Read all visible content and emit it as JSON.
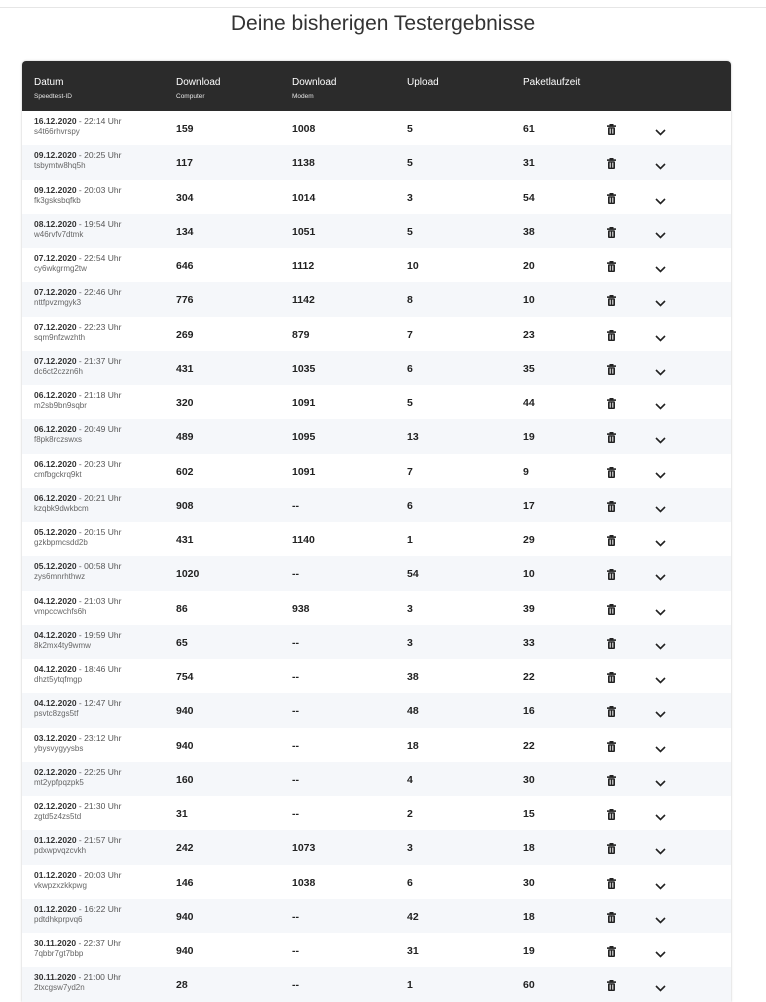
{
  "title": "Deine bisherigen Testergebnisse",
  "columns": [
    {
      "main": "Datum",
      "sub": "Speedtest-ID"
    },
    {
      "main": "Download",
      "sub": "Computer"
    },
    {
      "main": "Download",
      "sub": "Modem"
    },
    {
      "main": "Upload",
      "sub": ""
    },
    {
      "main": "Paketlaufzeit",
      "sub": ""
    }
  ],
  "rows": [
    {
      "date": "16.12.2020",
      "time": " - 22:14 Uhr",
      "id": "s4t66rhvrspy",
      "dl_pc": "159",
      "dl_modem": "1008",
      "ul": "5",
      "ping": "61"
    },
    {
      "date": "09.12.2020",
      "time": " - 20:25 Uhr",
      "id": "tsbymtw8hq5h",
      "dl_pc": "117",
      "dl_modem": "1138",
      "ul": "5",
      "ping": "31"
    },
    {
      "date": "09.12.2020",
      "time": " - 20:03 Uhr",
      "id": "fk3gsksbqfkb",
      "dl_pc": "304",
      "dl_modem": "1014",
      "ul": "3",
      "ping": "54"
    },
    {
      "date": "08.12.2020",
      "time": " - 19:54 Uhr",
      "id": "w46rvfv7dtmk",
      "dl_pc": "134",
      "dl_modem": "1051",
      "ul": "5",
      "ping": "38"
    },
    {
      "date": "07.12.2020",
      "time": " - 22:54 Uhr",
      "id": "cy6wkgrmg2tw",
      "dl_pc": "646",
      "dl_modem": "1112",
      "ul": "10",
      "ping": "20"
    },
    {
      "date": "07.12.2020",
      "time": " - 22:46 Uhr",
      "id": "nttfpvzmgyk3",
      "dl_pc": "776",
      "dl_modem": "1142",
      "ul": "8",
      "ping": "10"
    },
    {
      "date": "07.12.2020",
      "time": " - 22:23 Uhr",
      "id": "sqm9nfzwzhth",
      "dl_pc": "269",
      "dl_modem": "879",
      "ul": "7",
      "ping": "23"
    },
    {
      "date": "07.12.2020",
      "time": " - 21:37 Uhr",
      "id": "dc6ct2czzn6h",
      "dl_pc": "431",
      "dl_modem": "1035",
      "ul": "6",
      "ping": "35"
    },
    {
      "date": "06.12.2020",
      "time": " - 21:18 Uhr",
      "id": "m2sb9bn9sqbr",
      "dl_pc": "320",
      "dl_modem": "1091",
      "ul": "5",
      "ping": "44"
    },
    {
      "date": "06.12.2020",
      "time": " - 20:49 Uhr",
      "id": "f8pk8rczswxs",
      "dl_pc": "489",
      "dl_modem": "1095",
      "ul": "13",
      "ping": "19"
    },
    {
      "date": "06.12.2020",
      "time": " - 20:23 Uhr",
      "id": "cmfbgckrq9kt",
      "dl_pc": "602",
      "dl_modem": "1091",
      "ul": "7",
      "ping": "9"
    },
    {
      "date": "06.12.2020",
      "time": " - 20:21 Uhr",
      "id": "kzqbk9dwkbcm",
      "dl_pc": "908",
      "dl_modem": "--",
      "ul": "6",
      "ping": "17"
    },
    {
      "date": "05.12.2020",
      "time": " - 20:15 Uhr",
      "id": "gzkbpmcsdd2b",
      "dl_pc": "431",
      "dl_modem": "1140",
      "ul": "1",
      "ping": "29"
    },
    {
      "date": "05.12.2020",
      "time": " - 00:58 Uhr",
      "id": "zys6mnrhthwz",
      "dl_pc": "1020",
      "dl_modem": "--",
      "ul": "54",
      "ping": "10"
    },
    {
      "date": "04.12.2020",
      "time": " - 21:03 Uhr",
      "id": "vmpccwchfs6h",
      "dl_pc": "86",
      "dl_modem": "938",
      "ul": "3",
      "ping": "39"
    },
    {
      "date": "04.12.2020",
      "time": " - 19:59 Uhr",
      "id": "8k2mx4ty9wmw",
      "dl_pc": "65",
      "dl_modem": "--",
      "ul": "3",
      "ping": "33"
    },
    {
      "date": "04.12.2020",
      "time": " - 18:46 Uhr",
      "id": "dhzt5ytqfmgp",
      "dl_pc": "754",
      "dl_modem": "--",
      "ul": "38",
      "ping": "22"
    },
    {
      "date": "04.12.2020",
      "time": " - 12:47 Uhr",
      "id": "psvtc8zgs5tf",
      "dl_pc": "940",
      "dl_modem": "--",
      "ul": "48",
      "ping": "16"
    },
    {
      "date": "03.12.2020",
      "time": " - 23:12 Uhr",
      "id": "ybysvygyysbs",
      "dl_pc": "940",
      "dl_modem": "--",
      "ul": "18",
      "ping": "22"
    },
    {
      "date": "02.12.2020",
      "time": " - 22:25 Uhr",
      "id": "mt2ypfpqzpk5",
      "dl_pc": "160",
      "dl_modem": "--",
      "ul": "4",
      "ping": "30"
    },
    {
      "date": "02.12.2020",
      "time": " - 21:30 Uhr",
      "id": "zgtd5z4zs5td",
      "dl_pc": "31",
      "dl_modem": "--",
      "ul": "2",
      "ping": "15"
    },
    {
      "date": "01.12.2020",
      "time": " - 21:57 Uhr",
      "id": "pdxwpvqzcvkh",
      "dl_pc": "242",
      "dl_modem": "1073",
      "ul": "3",
      "ping": "18"
    },
    {
      "date": "01.12.2020",
      "time": " - 20:03 Uhr",
      "id": "vkwpzxzkkpwg",
      "dl_pc": "146",
      "dl_modem": "1038",
      "ul": "6",
      "ping": "30"
    },
    {
      "date": "01.12.2020",
      "time": " - 16:22 Uhr",
      "id": "pdtdhkprpvq6",
      "dl_pc": "940",
      "dl_modem": "--",
      "ul": "42",
      "ping": "18"
    },
    {
      "date": "30.11.2020",
      "time": " - 22:37 Uhr",
      "id": "7qbbr7gt7bbp",
      "dl_pc": "940",
      "dl_modem": "--",
      "ul": "31",
      "ping": "19"
    },
    {
      "date": "30.11.2020",
      "time": " - 21:00 Uhr",
      "id": "2txcgsw7yd2n",
      "dl_pc": "28",
      "dl_modem": "--",
      "ul": "1",
      "ping": "60"
    }
  ],
  "icons": {
    "delete": "trash-icon",
    "expand": "chevron-down-icon"
  },
  "colors": {
    "header_bg": "#2b2b2b",
    "row_alt": "#f5f7fa"
  }
}
